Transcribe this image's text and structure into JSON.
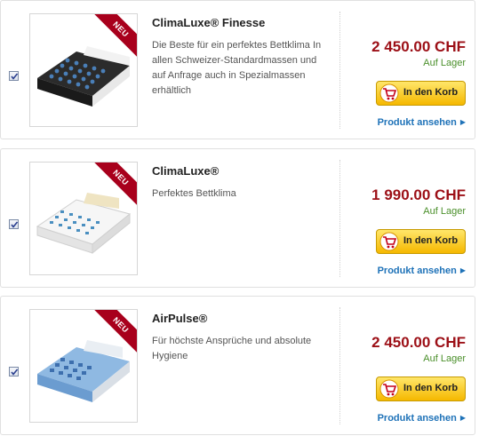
{
  "products": [
    {
      "title": "ClimaLuxe® Finesse",
      "description": "Die Beste für ein perfektes Bettklima In allen Schweizer-Standardmassen und auf Anfrage auch in Spezialmassen erhältlich",
      "price": "2 450.00 CHF",
      "stock": "Auf Lager",
      "badge": "NEU",
      "cart_label": "In den Korb",
      "view_label": "Produkt ansehen",
      "selected": true,
      "image_icon": "mattress-dark-image"
    },
    {
      "title": "ClimaLuxe®",
      "description": "Perfektes Bettklima",
      "price": "1 990.00 CHF",
      "stock": "Auf Lager",
      "badge": "NEU",
      "cart_label": "In den Korb",
      "view_label": "Produkt ansehen",
      "selected": true,
      "image_icon": "mattress-white-image"
    },
    {
      "title": "AirPulse®",
      "description": "Für höchste Ansprüche und absolute Hygiene",
      "price": "2 450.00 CHF",
      "stock": "Auf Lager",
      "badge": "NEU",
      "cart_label": "In den Korb",
      "view_label": "Produkt ansehen",
      "selected": true,
      "image_icon": "mattress-blue-image"
    }
  ],
  "colors": {
    "price": "#9c0f16",
    "stock": "#4a8f2a",
    "link": "#1e72b8",
    "badge": "#a8001c",
    "button": "#f5b800"
  }
}
